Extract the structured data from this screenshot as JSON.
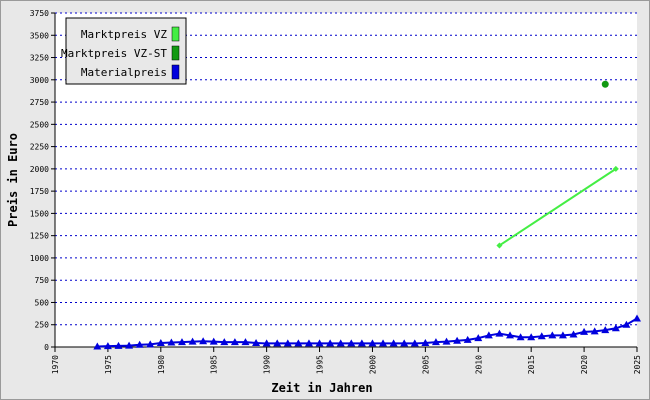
{
  "chart_data": {
    "type": "line",
    "xlabel": "Zeit in Jahren",
    "ylabel": "Preis in Euro",
    "xlim": [
      1970,
      2025
    ],
    "ylim": [
      0,
      3750
    ],
    "grid": true,
    "legend_position": "top-left",
    "x_ticks": [
      1970,
      1975,
      1980,
      1985,
      1990,
      1995,
      2000,
      2005,
      2010,
      2015,
      2020,
      2025
    ],
    "y_ticks": [
      0,
      250,
      500,
      750,
      1000,
      1250,
      1500,
      1750,
      2000,
      2250,
      2500,
      2750,
      3000,
      3250,
      3500,
      3750
    ],
    "series": [
      {
        "name": "Marktpreis VZ",
        "color": "#44ee44",
        "marker": "diamond",
        "x": [
          2012,
          2023
        ],
        "values": [
          1140,
          2000
        ]
      },
      {
        "name": "Marktpreis VZ-ST",
        "color": "#119911",
        "marker": "circle",
        "x": [
          2022
        ],
        "values": [
          2950
        ]
      },
      {
        "name": "Materialpreis",
        "color": "#0000dd",
        "marker": "triangle",
        "x": [
          1974,
          1975,
          1976,
          1977,
          1978,
          1979,
          1980,
          1981,
          1982,
          1983,
          1984,
          1985,
          1986,
          1987,
          1988,
          1989,
          1990,
          1991,
          1992,
          1993,
          1994,
          1995,
          1996,
          1997,
          1998,
          1999,
          2000,
          2001,
          2002,
          2003,
          2004,
          2005,
          2006,
          2007,
          2008,
          2009,
          2010,
          2011,
          2012,
          2013,
          2014,
          2015,
          2016,
          2017,
          2018,
          2019,
          2020,
          2021,
          2022,
          2023,
          2024,
          2025
        ],
        "values": [
          5,
          10,
          12,
          15,
          25,
          30,
          45,
          50,
          55,
          60,
          65,
          60,
          55,
          55,
          55,
          45,
          40,
          40,
          40,
          40,
          40,
          40,
          40,
          40,
          40,
          40,
          40,
          40,
          40,
          40,
          40,
          45,
          55,
          60,
          70,
          80,
          100,
          130,
          150,
          130,
          110,
          110,
          120,
          130,
          130,
          140,
          170,
          175,
          190,
          210,
          250,
          320
        ]
      }
    ]
  }
}
